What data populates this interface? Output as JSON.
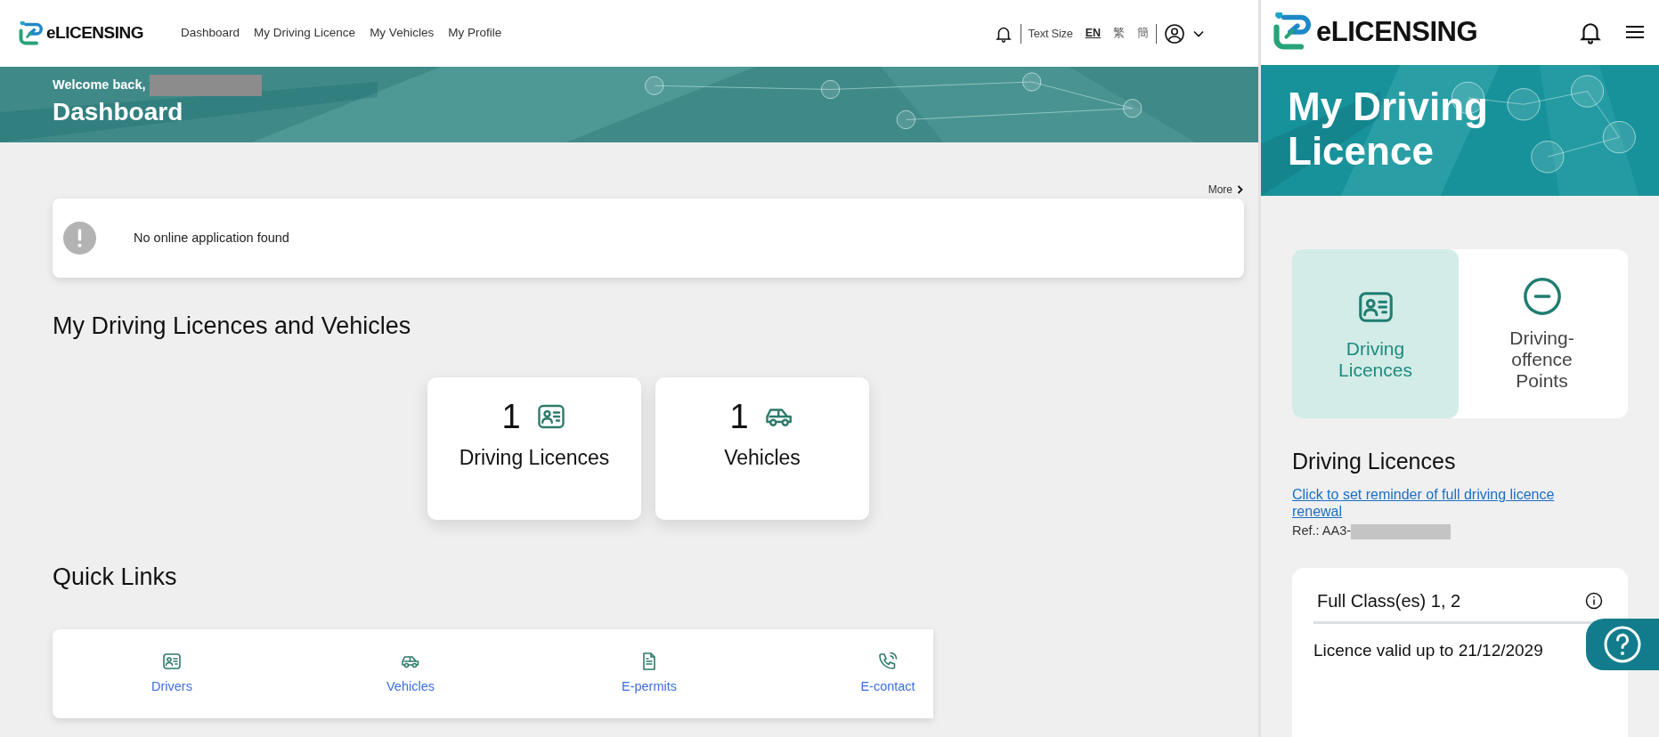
{
  "desktop": {
    "header": {
      "logo": "eLICENSING",
      "nav": [
        {
          "label": "Dashboard"
        },
        {
          "label": "My Driving Licence"
        },
        {
          "label": "My Vehicles"
        },
        {
          "label": "My Profile"
        }
      ],
      "text_size_label": "Text Size",
      "languages": [
        {
          "label": "EN",
          "selected": true
        },
        {
          "label": "繁",
          "selected": false
        },
        {
          "label": "簡",
          "selected": false
        }
      ]
    },
    "banner": {
      "greeting": "Welcome back,",
      "title": "Dashboard"
    },
    "more_link": "More",
    "alert": {
      "message": "No online application found"
    },
    "summary_heading": "My Driving Licences and Vehicles",
    "summary_cards": [
      {
        "count": "1",
        "label": "Driving Licences",
        "kind": "licence"
      },
      {
        "count": "1",
        "label": "Vehicles",
        "kind": "vehicle"
      }
    ],
    "quick_links_heading": "Quick Links",
    "quick_links": [
      {
        "label": "Drivers",
        "kind": "licence"
      },
      {
        "label": "Vehicles",
        "kind": "vehicle"
      },
      {
        "label": "E-permits",
        "kind": "document"
      },
      {
        "label": "E-contact",
        "kind": "phone"
      }
    ]
  },
  "mobile": {
    "logo": "eLICENSING",
    "banner_title": "My Driving Licence",
    "tabs": [
      {
        "label": "Driving Licences",
        "selected": true,
        "kind": "licence"
      },
      {
        "label": "Driving-offence Points",
        "selected": false,
        "kind": "points"
      }
    ],
    "section_heading": "Driving Licences",
    "reminder_link": "Click to set reminder of full driving licence renewal",
    "ref": "Ref.: AA3-",
    "licence_card": {
      "classes": "Full Class(es) 1, 2",
      "validity": "Licence valid up to 21/12/2029"
    }
  }
}
